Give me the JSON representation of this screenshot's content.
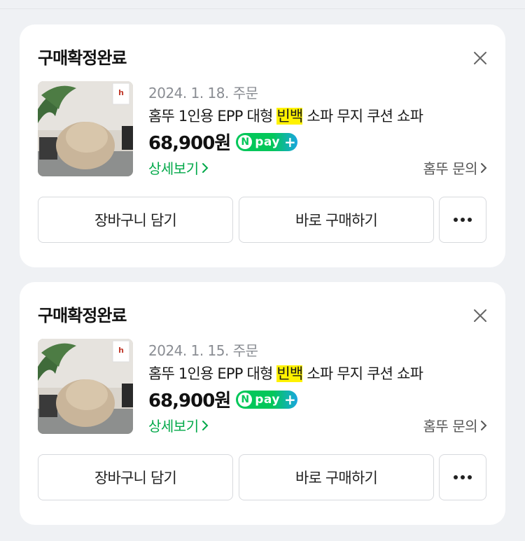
{
  "orders": [
    {
      "status_title": "구매확정완료",
      "order_date": "2024. 1. 18. 주문",
      "product": {
        "name_before": "홈뚜 1인용 EPP 대형 ",
        "name_highlight": "빈백",
        "name_after": " 소파 무지 쿠션 쇼파"
      },
      "price": "68,900원",
      "npay_badge": {
        "n": "N",
        "text": "pay",
        "plus": "+"
      },
      "detail_link": "상세보기",
      "inquiry_link": "홈뚜 문의",
      "buttons": {
        "cart": "장바구니 담기",
        "buy_now": "바로 구매하기"
      },
      "image_icon": "beanbag-product-photo"
    },
    {
      "status_title": "구매확정완료",
      "order_date": "2024. 1. 15. 주문",
      "product": {
        "name_before": "홈뚜 1인용 EPP 대형 ",
        "name_highlight": "빈백",
        "name_after": " 소파 무지 쿠션 쇼파"
      },
      "price": "68,900원",
      "npay_badge": {
        "n": "N",
        "text": "pay",
        "plus": "+"
      },
      "detail_link": "상세보기",
      "inquiry_link": "홈뚜 문의",
      "buttons": {
        "cart": "장바구니 담기",
        "buy_now": "바로 구매하기"
      },
      "image_icon": "beanbag-product-photo"
    }
  ],
  "colors": {
    "accent_green": "#03a94a",
    "npay_green": "#03c75a",
    "highlight": "#fff200"
  }
}
